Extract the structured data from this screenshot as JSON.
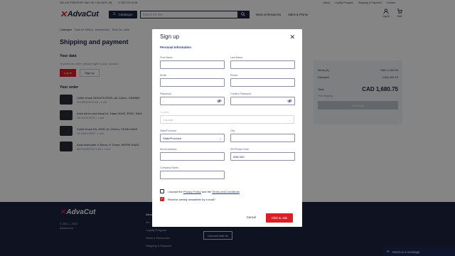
{
  "topbar": {
    "address": "300-240 FREEPORT WAY SE, CALGARY, AB",
    "phone": "+1 833 723 34 98",
    "links": [
      "About",
      "Loyalty Program",
      "Shipping & Payment",
      "Contact"
    ]
  },
  "header": {
    "brand": "AdvaCut",
    "catalog_label": "Catalogue",
    "search_placeholder": "Search the site",
    "nav": [
      "News & Resources",
      "Sales & Promo"
    ],
    "login_label": "Log In",
    "cart_label": "Cart",
    "cart_count": "3"
  },
  "breadcrumb": [
    "Catalogue",
    "Tools for Milling",
    "Accessories",
    "Tools for Lathe"
  ],
  "page_title": "Shipping and payment",
  "your_data": {
    "heading": "Your data",
    "hint": "To place an order, please login to your account",
    "login_button": "Log In",
    "signup_button": "Sign up"
  },
  "your_order": {
    "heading": "Your order",
    "items": [
      {
        "name": "Collet chuck SK40x70 ER25, ø2–16mm, DIN6989",
        "sku": "SK40ER25X70.AD",
        "qty": "1 unit"
      },
      {
        "name": "Axial driven tool AdvaCut, Haas VDI40, ER32, RAM",
        "sku": "HA.VDI40.ER32",
        "qty": "1 unit"
      },
      {
        "name": "Collet chuck EA, ER32 (2–20mm), VDI40 HAAS",
        "sku": "VA.VDI40.ER32",
        "qty": "1 unit"
      },
      {
        "name": "Axial toolholder 4 40mm, H 70mm, BMT65 HAAS",
        "sku": "BMT65.BDT40.72.DS",
        "qty": "1 unit"
      }
    ]
  },
  "summary": {
    "items_label": "Items (4)",
    "items_value": "CAD 2,100.94",
    "discount_label": "Discount",
    "discount_value": "-CAD 420.19",
    "total_label": "Total",
    "total_value": "CAD 1,680.75",
    "shipping_note": "Free shipping",
    "checkout_button": "Checkout"
  },
  "footer": {
    "brand": "AdvaCut",
    "copyright": "© 2021 – 2023",
    "site": "Advacut.ca",
    "column_heading": "About",
    "links": [
      "Wi...",
      "Loyalty Program",
      "News & Resources",
      "Shipping & Payment"
    ],
    "connect_button": "Connect with Us"
  },
  "send_message": "Send us a message",
  "modal": {
    "title": "Sign up",
    "section": "Personal Information",
    "fields": {
      "first_name": {
        "label": "First Name",
        "value": ""
      },
      "last_name": {
        "label": "Last Name",
        "value": ""
      },
      "email": {
        "label": "Email",
        "value": ""
      },
      "phone": {
        "label": "Phone",
        "value": ""
      },
      "password": {
        "label": "Password",
        "value": ""
      },
      "confirm_password": {
        "label": "Confirm Password",
        "value": ""
      },
      "country": {
        "label": "Country",
        "value": "Canada"
      },
      "state": {
        "label": "State/Province",
        "value": "State/Province"
      },
      "city": {
        "label": "City",
        "value": ""
      },
      "street": {
        "label": "Street Address",
        "value": ""
      },
      "zip": {
        "label": "ZIP/Postal Code",
        "value": "A9A 9A9"
      },
      "company": {
        "label": "Company Name",
        "value": ""
      }
    },
    "accept": {
      "prefix": "I accept the",
      "privacy": "Privacy Policy",
      "and": "and the",
      "terms": "Terms and Conditions",
      "checked": false
    },
    "newsletter": {
      "label": "Receive weekly newsletter by e-mail?",
      "checked": true
    },
    "cancel_button": "Cancel",
    "submit_button": "Click to Join"
  },
  "colors": {
    "navy": "#1b2340",
    "brand_red": "#d81f26",
    "link_blue": "#2b3c7a"
  }
}
